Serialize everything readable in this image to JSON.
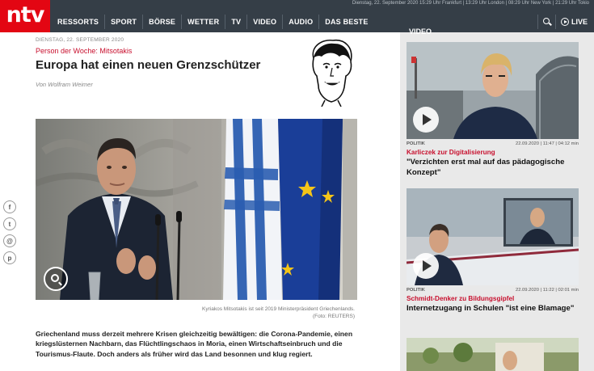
{
  "brand": {
    "logo_text": "ntv"
  },
  "ticker": "Dienstag, 22. September 2020 15:29 Uhr Frankfurt | 13:29 Uhr London | 08:29 Uhr New York | 21:29 Uhr Tokio",
  "nav": {
    "items": [
      "RESSORTS",
      "SPORT",
      "BÖRSE",
      "WETTER",
      "TV",
      "VIDEO",
      "AUDIO",
      "DAS BESTE"
    ],
    "live_label": "LIVE"
  },
  "article": {
    "date": "DIENSTAG, 22. SEPTEMBER 2020",
    "kicker": "Person der Woche: Mitsotakis",
    "headline": "Europa hat einen neuen Grenzschützer",
    "author": "Von Wolfram Weimer",
    "caption_line1": "Kyriakos Mitsotakis ist seit 2019 Ministerpräsident Griechenlands.",
    "caption_line2": "(Foto: REUTERS)",
    "lead": "Griechenland muss derzeit mehrere Krisen gleichzeitig bewältigen: die Corona-Pandemie, einen kriegslüsternen Nachbarn, das Flüchtlingschaos in Moria, einen Wirtschaftseinbruch und die Tourismus-Flaute. Doch anders als früher wird das Land besonnen und klug regiert."
  },
  "share": [
    "f",
    "t",
    "@",
    "p"
  ],
  "sidebar": {
    "title": "VIDEO",
    "teasers": [
      {
        "category": "POLITIK",
        "timestamp": "22.09.2020 | 11:47 | 04:12 min",
        "kicker": "Karliczek zur Digitalisierung",
        "headline": "\"Verzichten erst mal auf das pädagogische Konzept\""
      },
      {
        "category": "POLITIK",
        "timestamp": "22.09.2020 | 11:22 | 02:01 min",
        "kicker": "Schmidt-Denker zu Bildungsgipfel",
        "headline": "Internetzugang in Schulen \"ist eine Blamage\""
      }
    ]
  },
  "colors": {
    "brand_red": "#e30613",
    "nav_bg": "#353e47",
    "kicker_red": "#c8102e"
  }
}
